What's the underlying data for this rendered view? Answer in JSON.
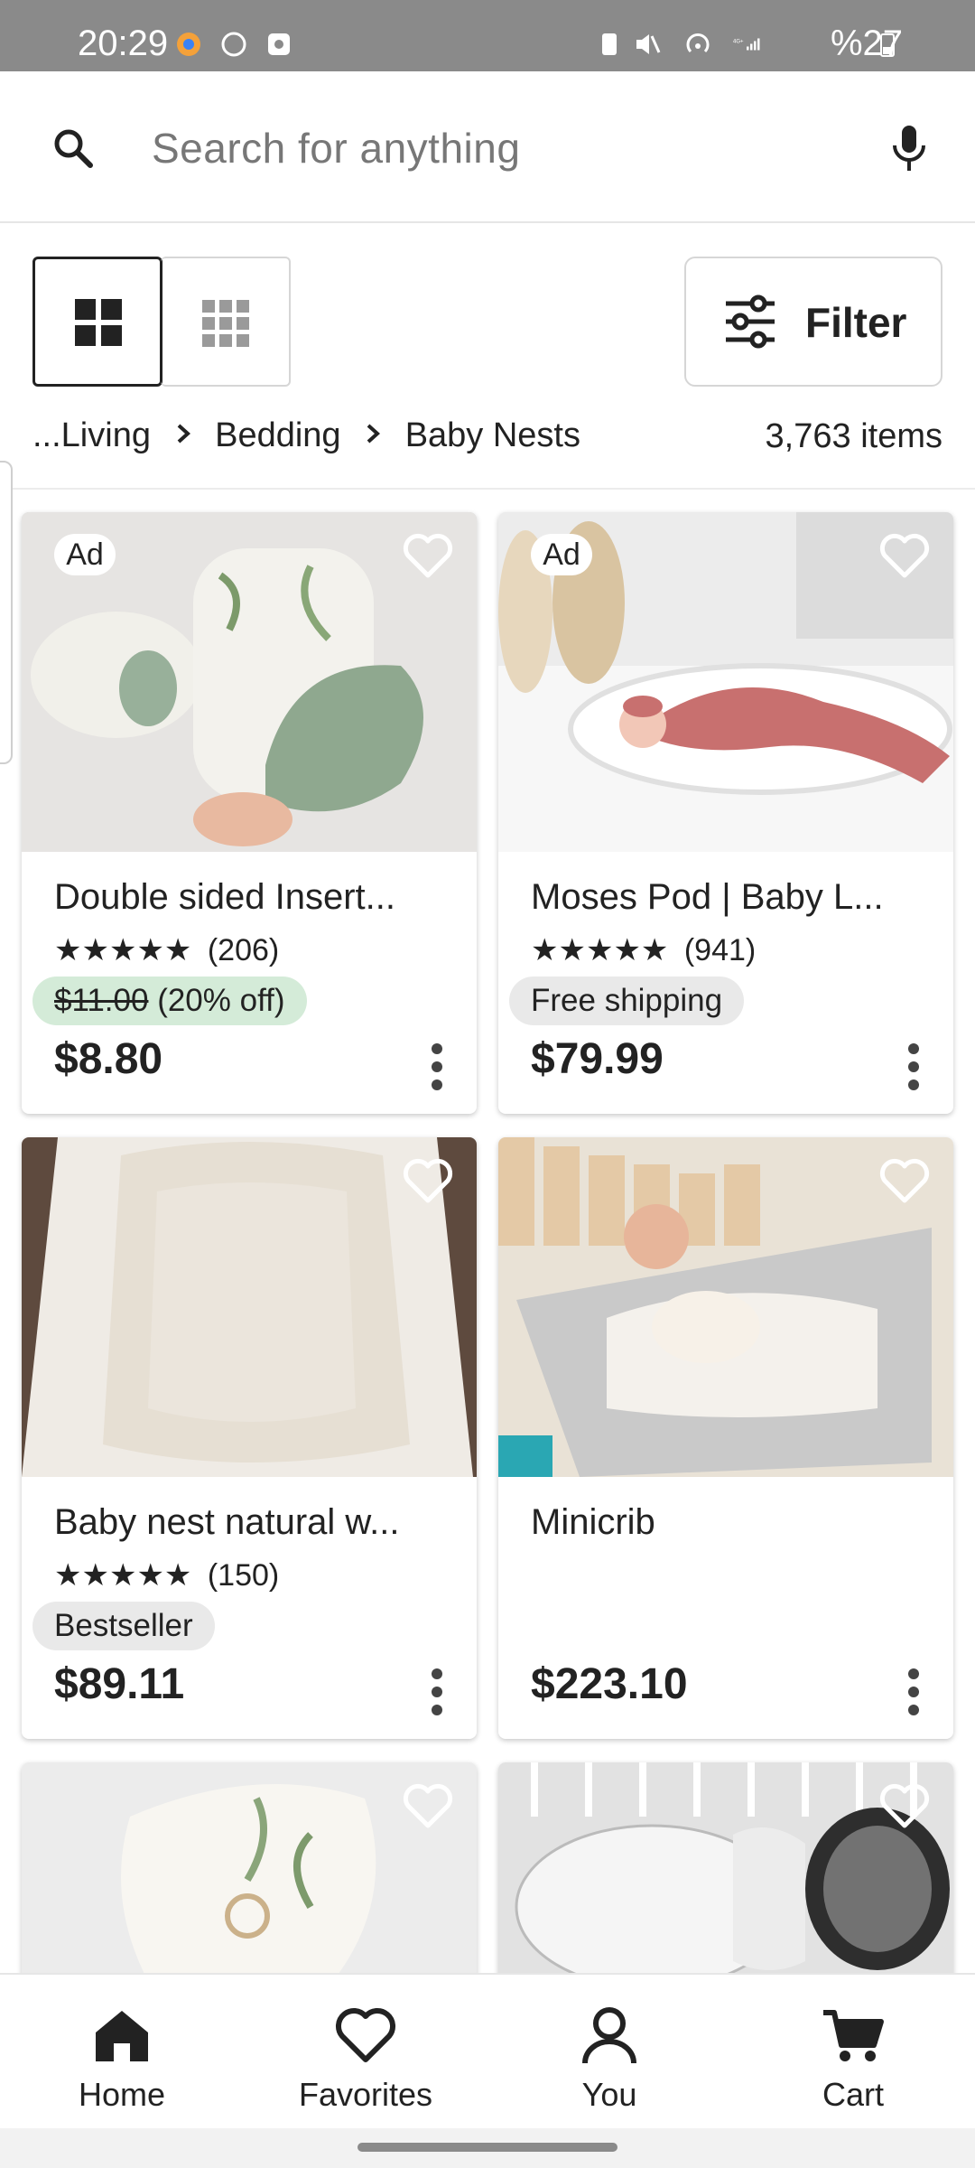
{
  "status_bar": {
    "time": "20:29",
    "battery_text": "%27"
  },
  "search": {
    "placeholder": "Search for anything"
  },
  "toolbar": {
    "filter_label": "Filter"
  },
  "breadcrumb": {
    "items": [
      "...Living",
      "Bedding",
      "Baby Nests"
    ],
    "count": "3,763 items"
  },
  "listings": [
    {
      "ad": "Ad",
      "title": "Double sided Insert...",
      "stars": "★★★★★",
      "rating_count": "(206)",
      "original_price": "$11.00",
      "discount": "(20% off)",
      "price": "$8.80"
    },
    {
      "ad": "Ad",
      "title": "Moses Pod | Baby L...",
      "stars": "★★★★★",
      "rating_count": "(941)",
      "badge": "Free shipping",
      "price": "$79.99"
    },
    {
      "title": "Baby nest natural w...",
      "stars": "★★★★★",
      "rating_count": "(150)",
      "badge": "Bestseller",
      "price": "$89.11"
    },
    {
      "title": "Minicrib",
      "price": "$223.10"
    },
    {},
    {}
  ],
  "bottom_nav": {
    "items": [
      {
        "label": "Home",
        "icon": "home-icon",
        "active": true
      },
      {
        "label": "Favorites",
        "icon": "heart-icon"
      },
      {
        "label": "You",
        "icon": "person-icon"
      },
      {
        "label": "Cart",
        "icon": "cart-icon"
      }
    ]
  },
  "colors": {
    "status_bar": "#8a8a8a",
    "discount_pill": "#d4ebd8",
    "neutral_pill": "#e9e9e9",
    "text": "#222222"
  }
}
